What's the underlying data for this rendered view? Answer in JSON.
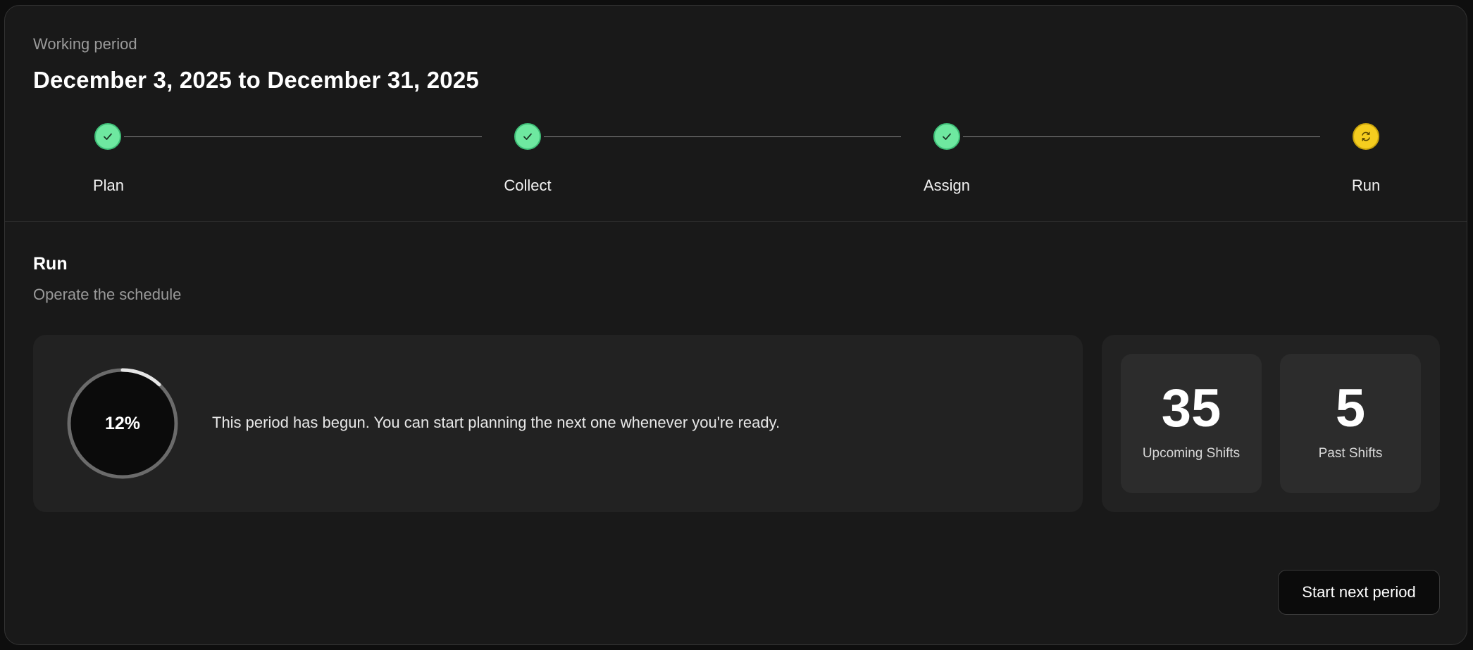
{
  "header": {
    "period_label": "Working period",
    "period_range": "December 3, 2025 to December 31, 2025"
  },
  "stepper": {
    "steps": [
      {
        "label": "Plan",
        "status": "done",
        "icon": "check-icon"
      },
      {
        "label": "Collect",
        "status": "done",
        "icon": "check-icon"
      },
      {
        "label": "Assign",
        "status": "done",
        "icon": "check-icon"
      },
      {
        "label": "Run",
        "status": "active",
        "icon": "refresh-icon"
      }
    ],
    "done_color": "#6ee8a0",
    "active_color": "#f5cd1f"
  },
  "section": {
    "title": "Run",
    "subtitle": "Operate the schedule"
  },
  "progress": {
    "percent": 12,
    "percent_label": "12%",
    "message": "This period has begun. You can start planning the next one whenever you're ready."
  },
  "stats": [
    {
      "value": "35",
      "label": "Upcoming Shifts"
    },
    {
      "value": "5",
      "label": "Past Shifts"
    }
  ],
  "actions": {
    "next_period_label": "Start next period"
  }
}
